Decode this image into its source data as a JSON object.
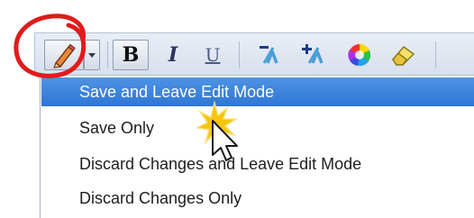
{
  "toolbar": {
    "buttons": [
      {
        "icon": "pencil-icon",
        "name": "edit-mode"
      },
      {
        "icon": "dropdown-arrow-icon",
        "name": "edit-menu-arrow"
      },
      {
        "label": "B",
        "name": "bold"
      },
      {
        "label": "I",
        "name": "italic"
      },
      {
        "label": "U",
        "name": "underline"
      },
      {
        "icon": "decrease-indent-icon",
        "name": "text-shrink"
      },
      {
        "icon": "increase-indent-icon",
        "name": "text-grow"
      },
      {
        "icon": "color-wheel-icon",
        "name": "color"
      },
      {
        "icon": "eraser-icon",
        "name": "eraser"
      }
    ]
  },
  "menu": {
    "items": [
      {
        "label": "Save and Leave Edit Mode",
        "selected": true
      },
      {
        "label": "Save Only",
        "selected": false
      },
      {
        "label": "Discard Changes and Leave Edit Mode",
        "selected": false
      },
      {
        "label": "Discard Changes Only",
        "selected": false
      }
    ]
  },
  "colors": {
    "highlight": "#3a82dc",
    "annotation_circle": "#e11b1b",
    "click_burst": "#f5c400"
  }
}
